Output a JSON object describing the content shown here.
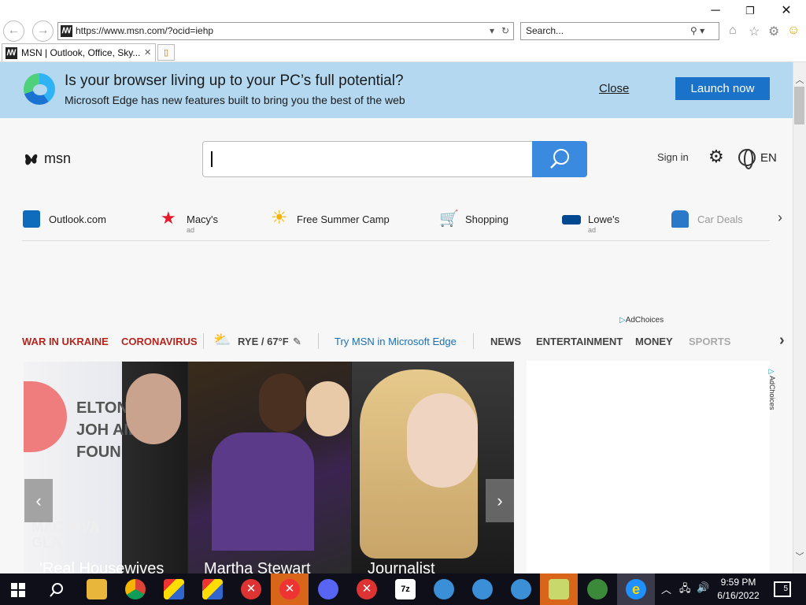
{
  "window": {
    "minimize": "─",
    "restore": "❐",
    "close": "✕"
  },
  "browser": {
    "back": "←",
    "forward": "→",
    "url": "https://www.msn.com/?ocid=iehp",
    "search_placeholder": "Search...",
    "tab_title": "MSN | Outlook, Office, Sky...",
    "tab_close": "✕"
  },
  "banner": {
    "title": "Is your browser living up to your PC’s full potential?",
    "subtitle": "Microsoft Edge has new features built to bring you the best of the web",
    "close": "Close",
    "launch": "Launch now"
  },
  "msn": {
    "logo": "msn",
    "signin": "Sign in",
    "lang": "EN"
  },
  "quicklinks": [
    {
      "label": "Outlook.com",
      "ad": "",
      "color": "#0f6cbd"
    },
    {
      "label": "Macy's",
      "ad": "ad",
      "color": "#e21a2c"
    },
    {
      "label": "Free Summer Camp",
      "ad": "",
      "color": "#f5b300"
    },
    {
      "label": "Shopping",
      "ad": "",
      "color": "#1a6fd0"
    },
    {
      "label": "Lowe's",
      "ad": "ad",
      "color": "#004990"
    },
    {
      "label": "Car Deals",
      "ad": "",
      "color": "#2a78c8"
    }
  ],
  "adchoices": "AdChoices",
  "topnav": {
    "war": "WAR IN UKRAINE",
    "corona": "CORONAVIRUS",
    "weather": "RYE / 67°F",
    "edge": "Try MSN in Microsoft Edge",
    "news": "NEWS",
    "ent": "ENTERTAINMENT",
    "money": "MONEY",
    "sports": "SPORTS"
  },
  "cards": [
    {
      "caption": "'Real Housewives",
      "sign_text": "ELTON JOH AIDS FOUN",
      "brand": "MAC VIVA GLA"
    },
    {
      "caption": "Martha Stewart"
    },
    {
      "caption": "Journalist"
    }
  ],
  "taskbar": {
    "time": "9:59 PM",
    "date": "6/16/2022",
    "notifications": "5"
  }
}
